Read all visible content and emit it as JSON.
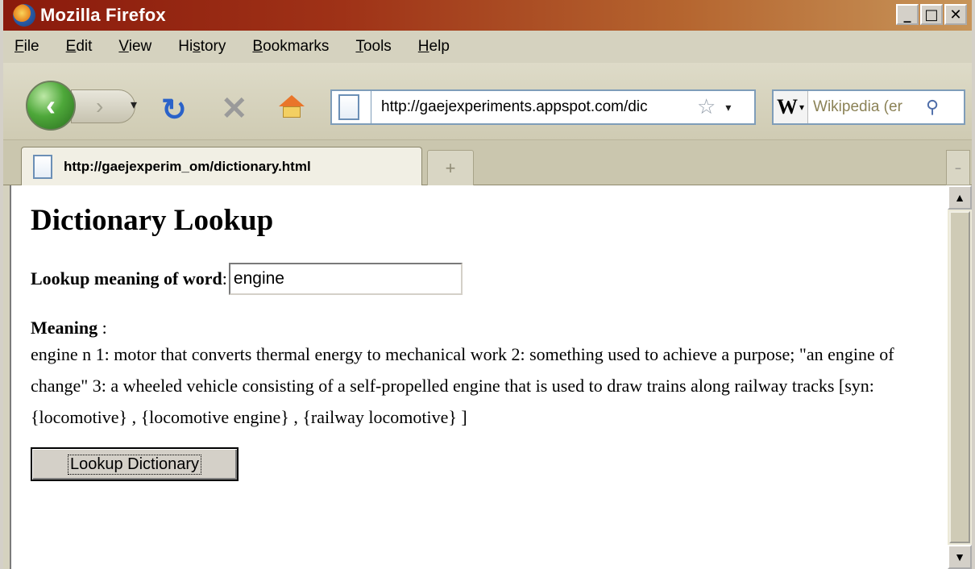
{
  "window": {
    "title": "Mozilla Firefox"
  },
  "menu": [
    "File",
    "Edit",
    "View",
    "History",
    "Bookmarks",
    "Tools",
    "Help"
  ],
  "menu_access_keys": [
    "F",
    "E",
    "V",
    "s",
    "B",
    "T",
    "H"
  ],
  "toolbar": {
    "url": "http://gaejexperiments.appspot.com/dic",
    "search_placeholder": "Wikipedia (er",
    "search_engine_letter": "W"
  },
  "tabs": [
    {
      "title": "http://gaejexperim_om/dictionary.html"
    }
  ],
  "page": {
    "heading": "Dictionary Lookup",
    "lookup_label": "Lookup meaning of word",
    "lookup_colon": ":",
    "word_value": "engine",
    "meaning_label": "Meaning",
    "meaning_colon": " :",
    "meaning_text": "engine n 1: motor that converts thermal energy to mechanical work 2: something used to achieve a purpose; \"an engine of change\" 3: a wheeled vehicle consisting of a self-propelled engine that is used to draw trains along railway tracks [syn: {locomotive} , {locomotive engine} , {railway locomotive} ]",
    "button_label": "Lookup Dictionary"
  },
  "colors": {
    "titlebar_start": "#8a1a0c",
    "titlebar_end": "#c7955a",
    "chrome": "#d5d2bf"
  }
}
